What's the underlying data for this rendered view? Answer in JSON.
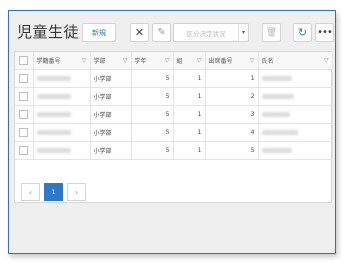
{
  "header": {
    "title": "児童生徒",
    "new_label": "新規",
    "close_glyph": "✕",
    "edit_glyph": "✎",
    "status_dropdown": {
      "placeholder": "区分決定状況",
      "arrow": "▾"
    },
    "trash_glyph": "🗑",
    "refresh_glyph": "↻",
    "more_glyph": "•••"
  },
  "table": {
    "columns": [
      "学籍番号",
      "学部",
      "学年",
      "組",
      "出席番号",
      "氏名"
    ],
    "filter_glyph": "▽",
    "rows": [
      {
        "dept": "小学部",
        "grade": "5",
        "class": "1",
        "attendance": "1"
      },
      {
        "dept": "小学部",
        "grade": "5",
        "class": "1",
        "attendance": "2"
      },
      {
        "dept": "小学部",
        "grade": "5",
        "class": "1",
        "attendance": "3"
      },
      {
        "dept": "小学部",
        "grade": "5",
        "class": "1",
        "attendance": "4"
      },
      {
        "dept": "小学部",
        "grade": "5",
        "class": "1",
        "attendance": "5"
      }
    ]
  },
  "pagination": {
    "prev": "‹",
    "current": "1",
    "next": "›"
  },
  "colors": {
    "accent": "#2f78c4",
    "frame_border": "#3a6fb0",
    "background": "#efefef"
  }
}
